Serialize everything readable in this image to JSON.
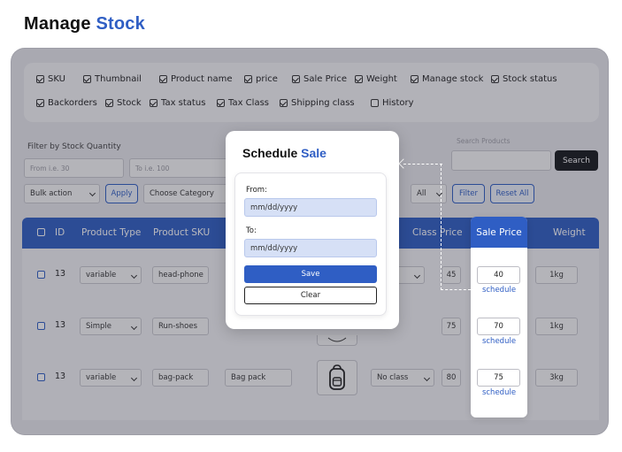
{
  "page": {
    "title_main": "Manage",
    "title_accent": "Stock"
  },
  "columns": [
    {
      "label": "SKU",
      "checked": true
    },
    {
      "label": "Thumbnail",
      "checked": true
    },
    {
      "label": "Product name",
      "checked": true
    },
    {
      "label": "price",
      "checked": true
    },
    {
      "label": "Sale Price",
      "checked": true
    },
    {
      "label": "Weight",
      "checked": true
    },
    {
      "label": "Manage stock",
      "checked": true
    },
    {
      "label": "Stock status",
      "checked": true
    },
    {
      "label": "Backorders",
      "checked": true
    },
    {
      "label": "Stock",
      "checked": true
    },
    {
      "label": "Tax status",
      "checked": true
    },
    {
      "label": "Tax Class",
      "checked": true
    },
    {
      "label": "Shipping class",
      "checked": true
    },
    {
      "label": "History",
      "checked": false
    }
  ],
  "filters": {
    "stock_label": "Filter by Stock Quantity",
    "from_placeholder": "From i.e. 30",
    "to_placeholder": "To i.e. 100",
    "search_label": "Search Products",
    "search_button": "Search",
    "bulk_action": "Bulk action",
    "apply_button": "Apply",
    "choose_category": "Choose Category",
    "all_select": "All",
    "filter_button": "Filter",
    "reset_button": "Reset All"
  },
  "table": {
    "headers": {
      "id": "ID",
      "product_type": "Product Type",
      "product_sku": "Product SKU",
      "class": "Class",
      "price": "Price",
      "sale_price": "Sale Price",
      "weight": "Weight"
    },
    "rows": [
      {
        "id": "13",
        "type": "variable",
        "sku": "head-phone",
        "name": "",
        "class": "",
        "price": "45",
        "sale_price": "40",
        "schedule": "schedule",
        "weight": "1kg",
        "thumb_icon": "none"
      },
      {
        "id": "13",
        "type": "Simple",
        "sku": "Run-shoes",
        "name": "",
        "class": "",
        "price": "75",
        "sale_price": "70",
        "schedule": "schedule",
        "weight": "1kg",
        "thumb_icon": "shoe-icon"
      },
      {
        "id": "13",
        "type": "variable",
        "sku": "bag-pack",
        "name": "Bag pack",
        "class": "No class",
        "price": "80",
        "sale_price": "75",
        "schedule": "schedule",
        "weight": "3kg",
        "thumb_icon": "backpack-icon"
      }
    ]
  },
  "modal": {
    "title_main": "Schedule",
    "title_accent": "Sale",
    "from_label": "From:",
    "from_value": "mm/dd/yyyy",
    "to_label": "To:",
    "to_value": "mm/dd/yyyy",
    "save_button": "Save",
    "clear_button": "Clear"
  },
  "colors": {
    "accent": "#2f5ec4",
    "dark_button": "#16181c",
    "date_field": "#d6e0f6"
  }
}
